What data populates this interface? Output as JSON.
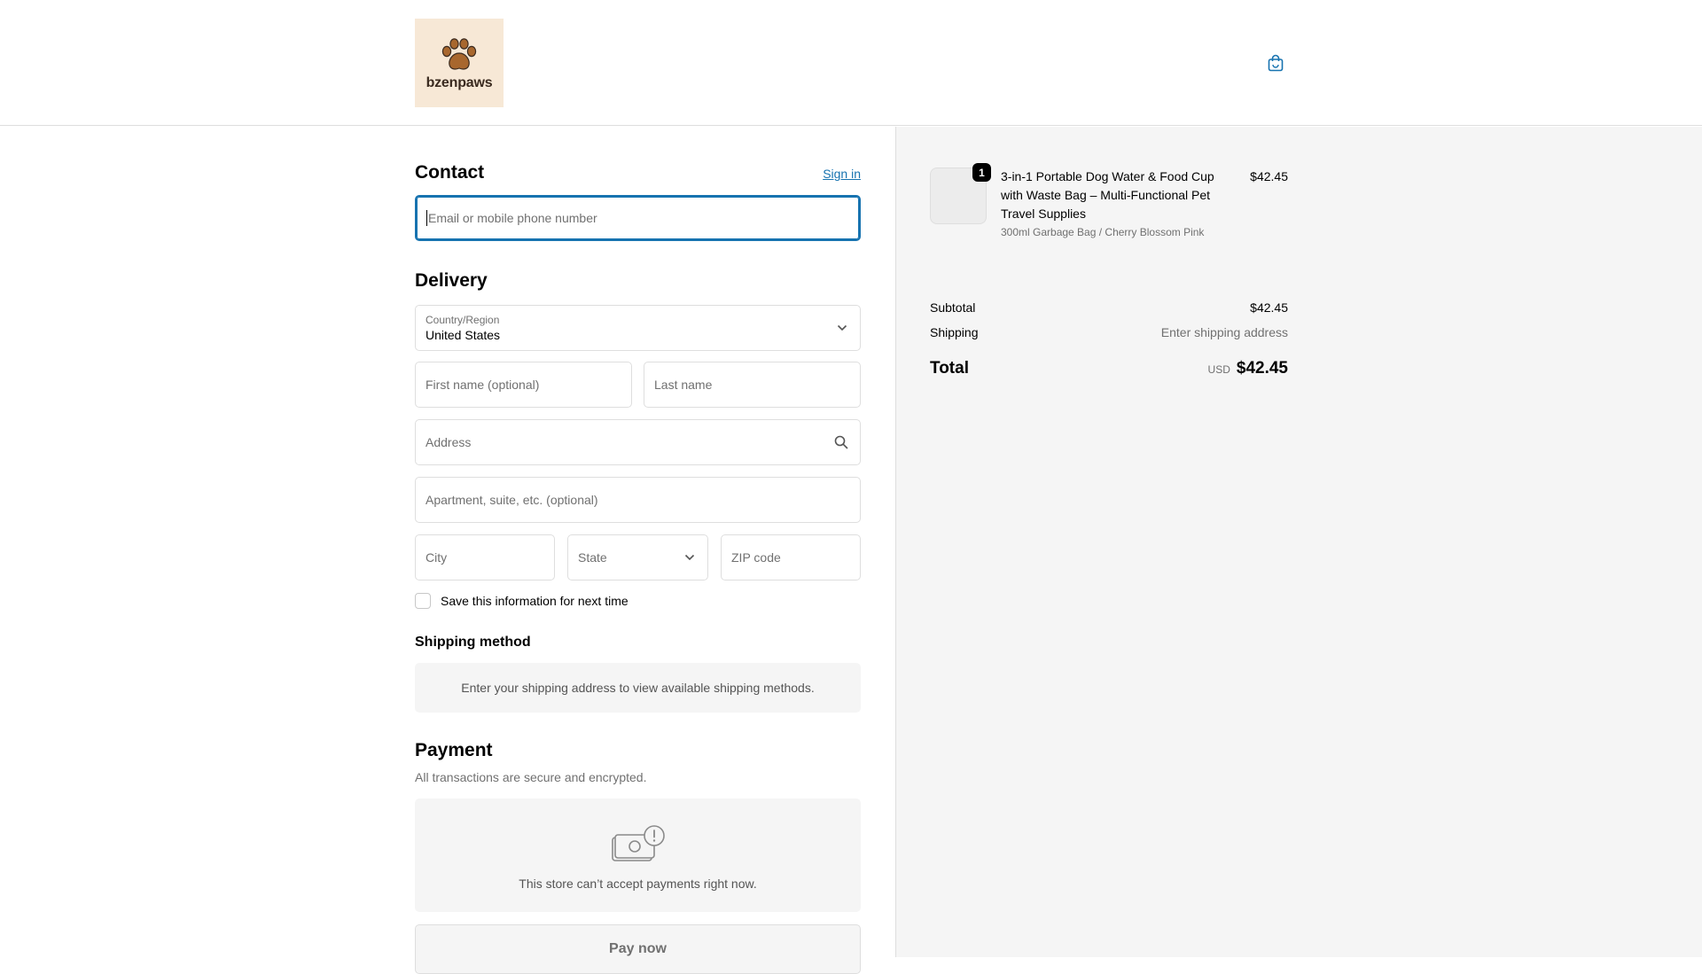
{
  "header": {
    "logo_text": "bzenpaws",
    "cart_icon": "shopping-bag-icon"
  },
  "contact": {
    "title": "Contact",
    "sign_in": "Sign in",
    "email_placeholder": "Email or mobile phone number"
  },
  "delivery": {
    "title": "Delivery",
    "country_label": "Country/Region",
    "country_value": "United States",
    "first_name_placeholder": "First name (optional)",
    "last_name_placeholder": "Last name",
    "address_placeholder": "Address",
    "apartment_placeholder": "Apartment, suite, etc. (optional)",
    "city_placeholder": "City",
    "state_placeholder": "State",
    "zip_placeholder": "ZIP code",
    "save_info_label": "Save this information for next time"
  },
  "shipping_method": {
    "title": "Shipping method",
    "notice": "Enter your shipping address to view available shipping methods."
  },
  "payment": {
    "title": "Payment",
    "subtitle": "All transactions are secure and encrypted.",
    "unavailable_message": "This store can’t accept payments right now.",
    "pay_button": "Pay now"
  },
  "order_summary": {
    "item": {
      "quantity": "1",
      "name": "3-in-1 Portable Dog Water & Food Cup with Waste Bag – Multi-Functional Pet Travel Supplies",
      "variant": "300ml Garbage Bag / Cherry Blossom Pink",
      "price": "$42.45"
    },
    "subtotal_label": "Subtotal",
    "subtotal_value": "$42.45",
    "shipping_label": "Shipping",
    "shipping_value": "Enter shipping address",
    "total_label": "Total",
    "currency": "USD",
    "total_value": "$42.45"
  },
  "colors": {
    "accent": "#1773b0",
    "sidebar_bg": "#f5f5f5",
    "logo_bg": "#f7e8d6"
  }
}
